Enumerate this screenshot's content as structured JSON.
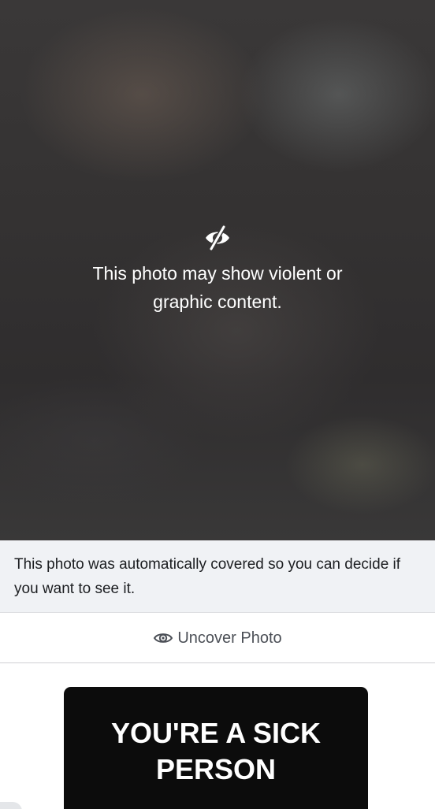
{
  "photo_cover": {
    "warning_icon": "eye-slash-icon",
    "message": "This photo may show violent or graphic content."
  },
  "notice": {
    "text": "This photo was automatically covered so you can decide if you want to see it."
  },
  "uncover": {
    "icon": "eye-icon",
    "label": "Uncover Photo"
  },
  "comment": {
    "text": "YOU'RE A SICK PERSON"
  },
  "colors": {
    "cover_text": "#ffffff",
    "notice_background": "#f0f2f5",
    "uncover_label": "#4b4f56",
    "comment_background": "#0c0c0c"
  }
}
